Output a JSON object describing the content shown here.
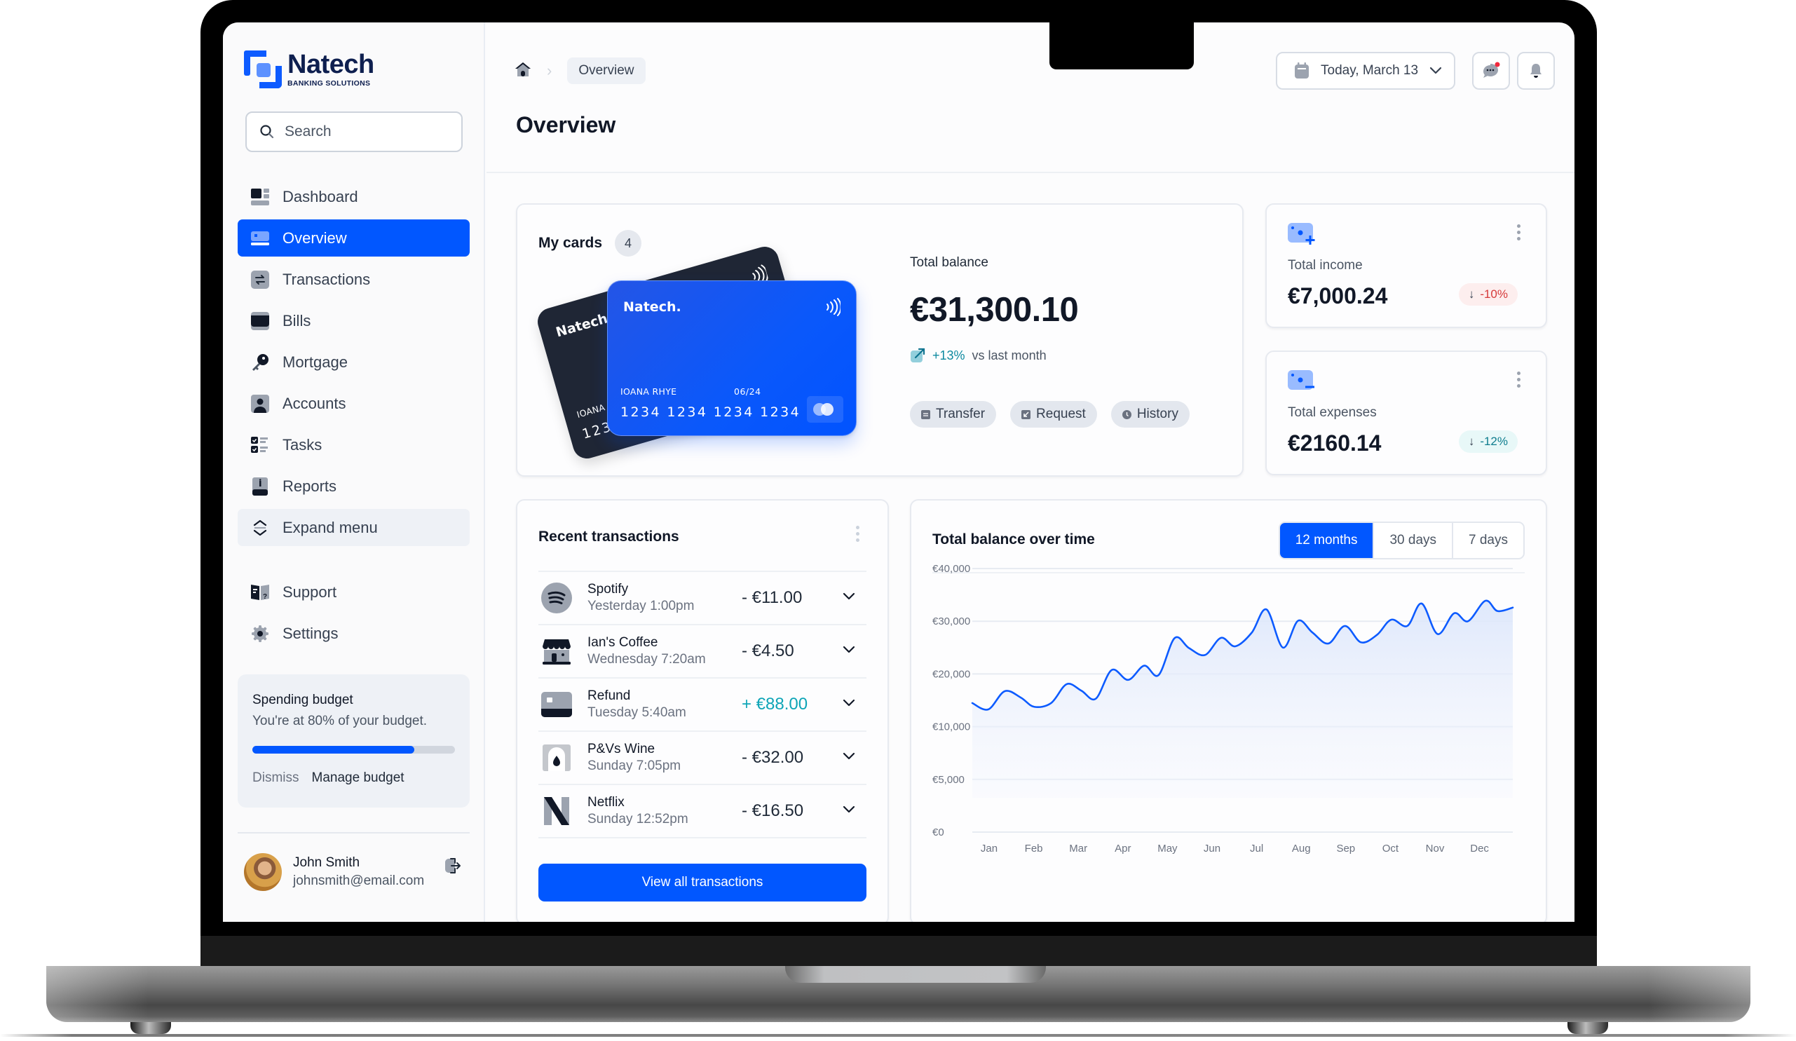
{
  "brand": {
    "name": "Natech",
    "tagline": "BANKING SOLUTIONS"
  },
  "search": {
    "placeholder": "Search"
  },
  "sidebar": {
    "items": [
      {
        "label": "Dashboard",
        "icon": "dashboard-icon",
        "active": false
      },
      {
        "label": "Overview",
        "icon": "card-icon",
        "active": true
      },
      {
        "label": "Transactions",
        "icon": "transfer-icon",
        "active": false
      },
      {
        "label": "Bills",
        "icon": "wallet-icon",
        "active": false
      },
      {
        "label": "Mortgage",
        "icon": "key-icon",
        "active": false
      },
      {
        "label": "Accounts",
        "icon": "user-icon",
        "active": false
      },
      {
        "label": "Tasks",
        "icon": "checklist-icon",
        "active": false
      },
      {
        "label": "Reports",
        "icon": "report-icon",
        "active": false
      },
      {
        "label": "Expand menu",
        "icon": "expand-icon",
        "active": false
      }
    ],
    "secondary": [
      {
        "label": "Support",
        "icon": "support-icon"
      },
      {
        "label": "Settings",
        "icon": "gear-icon"
      }
    ],
    "budget": {
      "title": "Spending budget",
      "description": "You're at 80% of your budget.",
      "progress_percent": 80,
      "dismiss_label": "Dismiss",
      "manage_label": "Manage budget"
    },
    "user": {
      "name": "John Smith",
      "email": "johnsmith@email.com"
    }
  },
  "header": {
    "breadcrumb": [
      "Overview"
    ],
    "title": "Overview",
    "date_label": "Today, March 13",
    "messages_unread": true
  },
  "cards": {
    "title": "My cards",
    "count": "4",
    "front": {
      "brand": "Natech.",
      "holder": "IOANA RHYE",
      "expiry": "06/24",
      "number": "1234 1234 1234 1234"
    },
    "back": {
      "brand": "Natech",
      "holder": "IOANA",
      "number": "123"
    }
  },
  "balance": {
    "label": "Total balance",
    "value": "€31,300.10",
    "trend_pct": "+13%",
    "trend_label": "vs last month",
    "actions": [
      "Transfer",
      "Request",
      "History"
    ]
  },
  "income": {
    "label": "Total income",
    "value": "€7,000.24",
    "delta": "-10%"
  },
  "expenses": {
    "label": "Total expenses",
    "value": "€2160.14",
    "delta": "-12%"
  },
  "transactions": {
    "title": "Recent transactions",
    "rows": [
      {
        "name": "Spotify",
        "time": "Yesterday 1:00pm",
        "amount": "- €11.00",
        "positive": false,
        "icon": "spotify-icon"
      },
      {
        "name": "Ian's Coffee",
        "time": "Wednesday 7:20am",
        "amount": "- €4.50",
        "positive": false,
        "icon": "store-icon"
      },
      {
        "name": "Refund",
        "time": "Tuesday 5:40am",
        "amount": "+ €88.00",
        "positive": true,
        "icon": "card-icon"
      },
      {
        "name": "P&Vs Wine",
        "time": "Sunday 7:05pm",
        "amount": "- €32.00",
        "positive": false,
        "icon": "wine-icon"
      },
      {
        "name": "Netflix",
        "time": "Sunday 12:52pm",
        "amount": "- €16.50",
        "positive": false,
        "icon": "netflix-icon"
      }
    ],
    "view_all_label": "View all transactions"
  },
  "chart_panel": {
    "title": "Total balance over time",
    "ranges": [
      "12 months",
      "30 days",
      "7 days"
    ],
    "active_range": "12 months"
  },
  "chart_data": {
    "type": "area",
    "title": "Total balance over time",
    "xlabel": "",
    "ylabel": "",
    "categories": [
      "Jan",
      "Feb",
      "Mar",
      "Apr",
      "May",
      "Jun",
      "Jul",
      "Aug",
      "Sep",
      "Oct",
      "Nov",
      "Dec"
    ],
    "y_ticks": [
      0,
      5000,
      10000,
      20000,
      30000,
      40000
    ],
    "y_tick_labels": [
      "€0",
      "€5,000",
      "€10,000",
      "€20,000",
      "€30,000",
      "€40,000"
    ],
    "y_scale": "piecewise (ticks evenly spaced)",
    "ylim": [
      0,
      40000
    ],
    "grid": true,
    "series": [
      {
        "name": "Total balance",
        "color": "#0d5bff",
        "x_month_index": [
          -0.38,
          -0.02,
          0.35,
          0.71,
          1.01,
          1.39,
          1.74,
          2.07,
          2.39,
          2.75,
          3.12,
          3.48,
          3.8,
          4.16,
          4.48,
          4.84,
          5.2,
          5.52,
          5.89,
          6.22,
          6.59,
          6.93,
          7.25,
          7.61,
          7.98,
          8.34,
          8.7,
          9.02,
          9.38,
          9.7,
          10.06,
          10.43,
          10.74,
          11.13,
          11.4,
          11.79
        ],
        "values": [
          14480,
          13270,
          16730,
          15520,
          13770,
          14480,
          18070,
          16820,
          15290,
          20750,
          18880,
          21570,
          19780,
          26800,
          24930,
          23590,
          26850,
          25240,
          27830,
          32240,
          25000,
          30090,
          27870,
          25780,
          29110,
          26000,
          27420,
          30300,
          29110,
          33360,
          27560,
          31510,
          30000,
          33880,
          31940,
          32590
        ]
      }
    ]
  },
  "colors": {
    "accent": "#0157ff",
    "positive": "#0ea5b7",
    "negative": "#d63a3a"
  }
}
